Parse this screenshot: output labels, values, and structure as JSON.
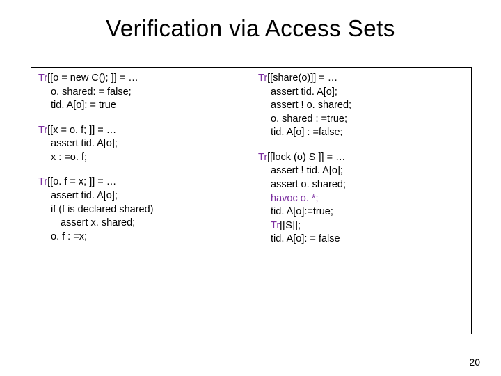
{
  "title": "Verification via Access Sets",
  "pagenum": "20",
  "left": {
    "b1": {
      "l1a": "Tr",
      "l1b": "[[o = new C(); ]] = …",
      "l2": "o. shared: = false;",
      "l3": "tid. A[o]: = true"
    },
    "b2": {
      "l1a": "Tr",
      "l1b": "[[x = o. f; ]] = …",
      "l2": "assert tid. A[o];",
      "l3": "x : =o. f;"
    },
    "b3": {
      "l1a": "Tr",
      "l1b": "[[o. f = x; ]] = …",
      "l2": "assert tid. A[o];",
      "l3": "if (f is declared shared)",
      "l4": "assert x. shared;",
      "l5": "o. f : =x;"
    }
  },
  "right": {
    "b1": {
      "l1a": "Tr",
      "l1b": "[[share(o)]] = …",
      "l2": "assert tid. A[o];",
      "l3": "assert ! o. shared;",
      "l4": "o. shared : =true;",
      "l5": "tid. A[o] : =false;"
    },
    "b2": {
      "l1a": "Tr",
      "l1b": "[[lock (o) S  ]] = …",
      "l2": "assert ! tid. A[o];",
      "l3": "assert o. shared;",
      "l4": "havoc o. *;",
      "l5": "tid. A[o]:=true;",
      "l6a": "Tr",
      "l6b": "[[S]];",
      "l7": "tid. A[o]: = false"
    }
  }
}
